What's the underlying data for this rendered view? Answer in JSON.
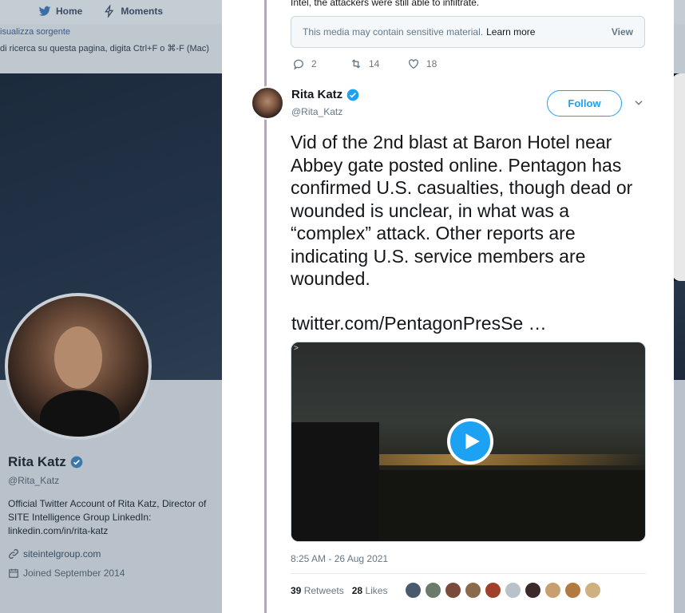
{
  "background": {
    "nav": [
      {
        "label": "Home",
        "icon": "home-bird-icon"
      },
      {
        "label": "Moments",
        "icon": "lightning-icon"
      }
    ],
    "notice_line1": "isualizza sorgente",
    "notice_line2": "di ricerca su questa pagina, digita Ctrl+F o ⌘-F (Mac)",
    "profile": {
      "name": "Rita Katz",
      "handle": "@Rita_Katz",
      "bio": "Official Twitter Account of Rita Katz, Director of SITE Intelligence Group LinkedIn: linkedin.com/in/rita-katz",
      "website": "siteintelgroup.com",
      "joined": "Joined September 2014"
    }
  },
  "previous_tweet": {
    "text_tail": "Intel, the attackers were still able to infiltrate.",
    "sensitive_notice": "This media may contain sensitive material.",
    "learn_more": "Learn more",
    "view_label": "View",
    "replies": "2",
    "retweets": "14",
    "likes": "18"
  },
  "tweet": {
    "author_name": "Rita Katz",
    "author_handle": "@Rita_Katz",
    "follow_label": "Follow",
    "text": "Vid of the 2nd blast at Baron Hotel near Abbey gate posted online. Pentagon has confirmed U.S. casualties, though dead or wounded is unclear, in what was a “complex” attack. Other reports are indicating U.S. service members are wounded.",
    "link": "twitter.com/PentagonPresSe …",
    "video_marker": ">",
    "timestamp": "8:25 AM - 26 Aug 2021",
    "retweet_count": "39",
    "retweet_label": "Retweets",
    "like_count": "28",
    "like_label": "Likes"
  },
  "colors": {
    "brand": "#1da1f2",
    "thread_line": "#b8a3c4"
  }
}
